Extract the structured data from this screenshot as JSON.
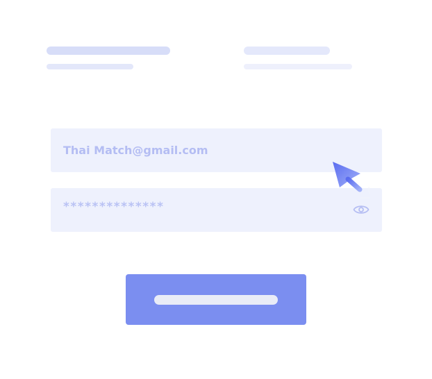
{
  "login_form": {
    "email_value": "Thai Match@gmail.com",
    "password_mask": "**************"
  },
  "icons": {
    "password_toggle": "eye-icon",
    "pointer": "cursor-arrow-icon"
  },
  "colors": {
    "accent": "#7b8ef0",
    "field_background": "#eef1fd",
    "field_text": "#b4bdf3",
    "placeholder_bar": "#d7ddf8"
  }
}
